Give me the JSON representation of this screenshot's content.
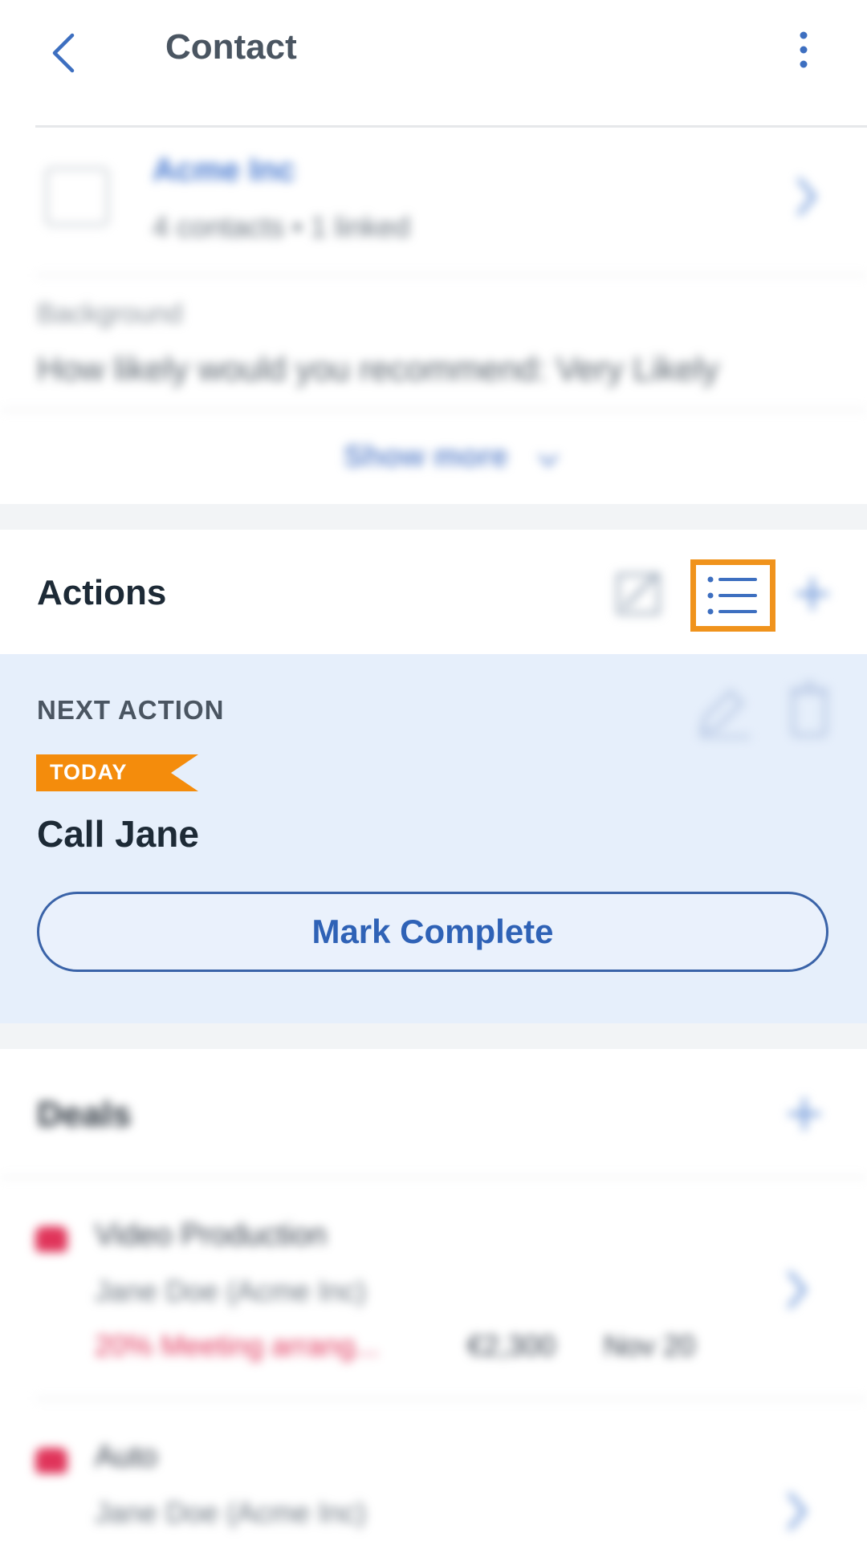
{
  "header": {
    "title": "Contact"
  },
  "company": {
    "name": "Acme Inc",
    "subtitle": "4 contacts • 1 linked"
  },
  "background": {
    "label": "Background",
    "value": "How likely would you recommend: Very Likely"
  },
  "show_more": "Show more",
  "actions": {
    "title": "Actions",
    "next_action_label": "NEXT ACTION",
    "badge": "TODAY",
    "action_title": "Call Jane",
    "mark_complete": "Mark Complete"
  },
  "deals": {
    "title": "Deals",
    "items": [
      {
        "title": "Video Production",
        "contact": "Jane Doe (Acme Inc)",
        "stage": "20% Meeting arrang...",
        "value": "€2,300",
        "date": "Nov 20"
      },
      {
        "title": "Auto",
        "contact": "Jane Doe (Acme Inc)"
      }
    ]
  },
  "colors": {
    "accent": "#2f62b6",
    "highlight": "#f0931c",
    "badge": "#f48c0c",
    "panel": "#e6effb",
    "deal": "#e0345a"
  }
}
